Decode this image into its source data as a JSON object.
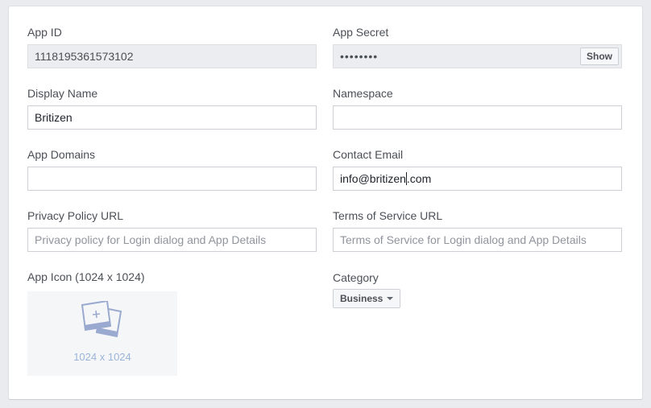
{
  "fields": {
    "app_id": {
      "label": "App ID",
      "value": "1118195361573102"
    },
    "app_secret": {
      "label": "App Secret",
      "masked_value": "••••••••",
      "show_label": "Show"
    },
    "display_name": {
      "label": "Display Name",
      "value": "Britizen"
    },
    "namespace": {
      "label": "Namespace",
      "value": ""
    },
    "app_domains": {
      "label": "App Domains",
      "value": ""
    },
    "contact_email": {
      "label": "Contact Email",
      "value_before_cursor": "info@britizen",
      "value_after_cursor": ".com"
    },
    "privacy_policy_url": {
      "label": "Privacy Policy URL",
      "placeholder": "Privacy policy for Login dialog and App Details"
    },
    "terms_of_service_url": {
      "label": "Terms of Service URL",
      "placeholder": "Terms of Service for Login dialog and App Details"
    },
    "app_icon": {
      "label": "App Icon (1024 x 1024)",
      "size_text": "1024 x 1024",
      "icon": "add-photo-icon"
    },
    "category": {
      "label": "Category",
      "selected": "Business"
    }
  },
  "colors": {
    "page_bg": "#e9ebee",
    "panel_bg": "#ffffff",
    "label_text": "#4b4f56",
    "disabled_input_bg": "#ebedf0",
    "icon_accent": "#9cb4d8"
  }
}
